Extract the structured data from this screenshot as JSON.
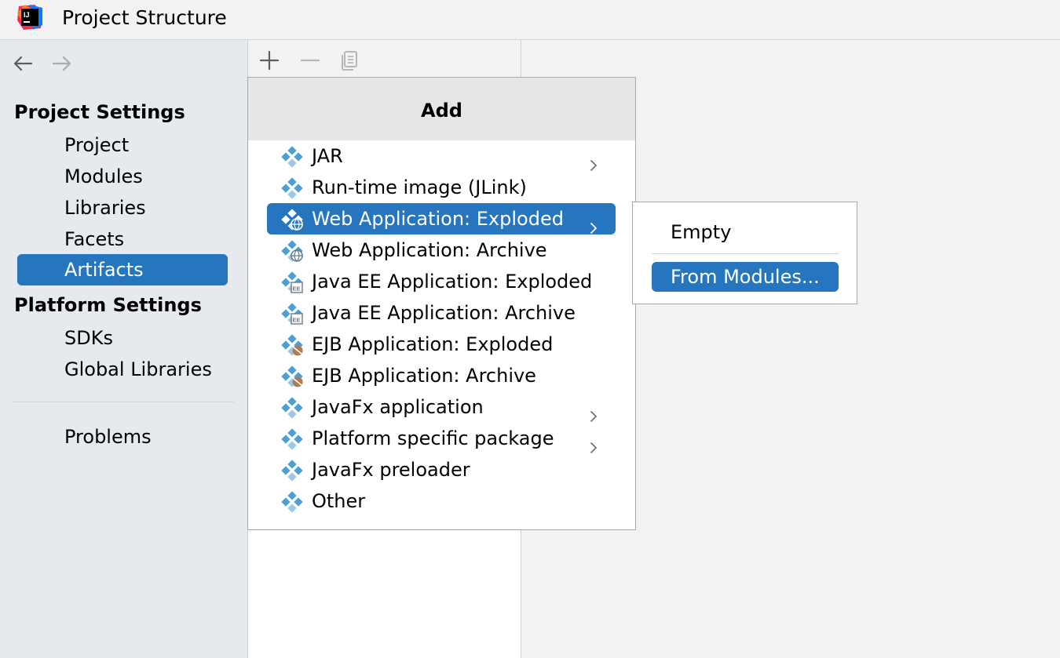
{
  "window": {
    "title": "Project Structure",
    "logo_icon": "intellij-idea-logo-icon",
    "logo_text": "IJ"
  },
  "sidebar": {
    "back_icon": "arrow-left-icon",
    "forward_icon": "arrow-right-icon",
    "project_settings_header": "Project Settings",
    "project_items": [
      {
        "label": "Project"
      },
      {
        "label": "Modules"
      },
      {
        "label": "Libraries"
      },
      {
        "label": "Facets"
      },
      {
        "label": "Artifacts",
        "selected": true
      }
    ],
    "platform_settings_header": "Platform Settings",
    "platform_items": [
      {
        "label": "SDKs"
      },
      {
        "label": "Global Libraries"
      }
    ],
    "problems_label": "Problems"
  },
  "toolbar": {
    "add_icon": "plus-icon",
    "remove_icon": "minus-icon",
    "copy_icon": "copy-icon"
  },
  "add_popup": {
    "title": "Add",
    "items": [
      {
        "label": "JAR",
        "icon": "artifact-icon",
        "has_submenu": true
      },
      {
        "label": "Run-time image (JLink)",
        "icon": "artifact-icon"
      },
      {
        "label": "Web Application: Exploded",
        "icon": "web-artifact-icon",
        "has_submenu": true,
        "selected": true
      },
      {
        "label": "Web Application: Archive",
        "icon": "web-artifact-icon"
      },
      {
        "label": "Java EE Application: Exploded",
        "icon": "ee-artifact-icon"
      },
      {
        "label": "Java EE Application: Archive",
        "icon": "ee-artifact-icon"
      },
      {
        "label": "EJB Application: Exploded",
        "icon": "ejb-artifact-icon"
      },
      {
        "label": "EJB Application: Archive",
        "icon": "ejb-artifact-icon"
      },
      {
        "label": "JavaFx application",
        "icon": "artifact-icon",
        "has_submenu": true
      },
      {
        "label": "Platform specific package",
        "icon": "artifact-icon",
        "has_submenu": true
      },
      {
        "label": "JavaFx preloader",
        "icon": "artifact-icon"
      },
      {
        "label": "Other",
        "icon": "artifact-icon"
      }
    ]
  },
  "submenu": {
    "items": [
      {
        "label": "Empty"
      },
      {
        "label": "From Modules...",
        "selected": true
      }
    ]
  },
  "colors": {
    "selection": "#2675bf",
    "sidebar_bg": "#e6e9ee",
    "popup_header_bg": "#e6e6e6",
    "artifact_icon_blue": "#4a9fd8"
  }
}
